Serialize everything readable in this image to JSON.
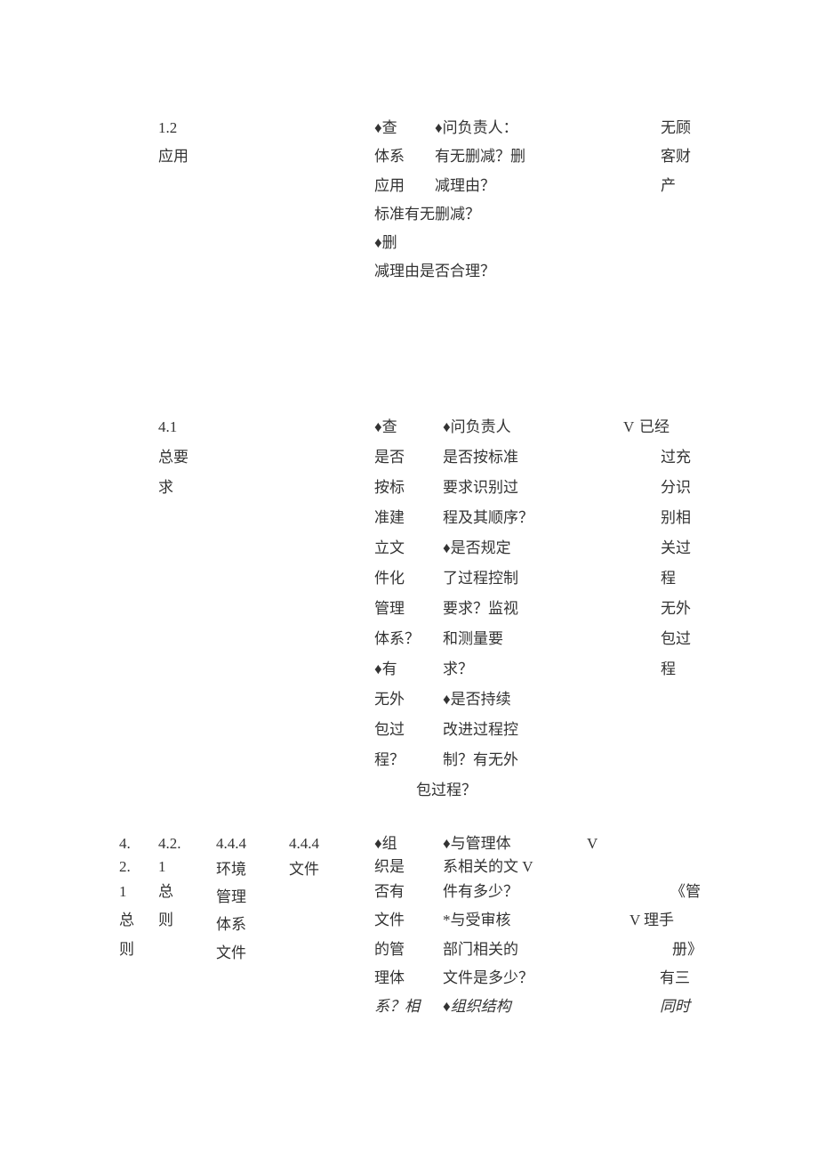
{
  "row1": {
    "c1": {
      "l1": "1.2",
      "l2": "应用"
    },
    "c4": {
      "l1": "♦查",
      "l2": "体系",
      "l3": "应用",
      "l4": "标准有无删减？",
      "l5": "♦删",
      "l6": "减理由是否合理？"
    },
    "c5": {
      "l1": "♦问负责人：",
      "l2": "有无删减？删",
      "l3": "减理由？"
    },
    "c7": {
      "l1": "无顾",
      "l2": "客财",
      "l3": "产"
    }
  },
  "row2": {
    "c1": {
      "l1": "4.1",
      "l2": "总要",
      "l3": "求"
    },
    "c4": {
      "l1": "♦查",
      "l2": "是否",
      "l3": "按标",
      "l4": "准建",
      "l5": "立文",
      "l6": "件化",
      "l7": "管理",
      "l8": "体系？",
      "l9": "♦有",
      "l10": "无外",
      "l11": "包过",
      "l12": "程？"
    },
    "c5": {
      "l1": "♦问负责人",
      "l2": "是否按标准",
      "l3": "要求识别过",
      "l4": "程及其顺序？",
      "l5": "♦是否规定",
      "l6": "了过程控制",
      "l7": "要求？监视",
      "l8": "和测量要",
      "l9": "求？",
      "l10": "♦是否持续",
      "l11": "改进过程控",
      "l12": "制？有无外",
      "l13": "包过程？"
    },
    "c6": {
      "l1": "V"
    },
    "c7": {
      "l1": "已经",
      "l2": "过充",
      "l3": "分识",
      "l4": "别相",
      "l5": "关过",
      "l6": "程",
      "l7": "",
      "l8": "无外",
      "l9": "包过",
      "l10": "程"
    }
  },
  "row3": {
    "c1a": {
      "l1": "4.",
      "l2": "2.",
      "l3": "1",
      "l4": "总",
      "l5": "则"
    },
    "c1b": {
      "l1": "4.2.",
      "l2": "1",
      "l3": "总",
      "l4": "则"
    },
    "c2a": {
      "l1": "4.4.4",
      "l2": "环境",
      "l3": "管理",
      "l4": "体系",
      "l5": "文件"
    },
    "c2b": {
      "l1": "4.4.4",
      "l2": "文件"
    },
    "c4": {
      "l1": "♦组",
      "l2": "织是",
      "l3": "否有",
      "l4": "文件",
      "l5": "的管",
      "l6": "理体",
      "l7": "系？相"
    },
    "c5": {
      "l1": "♦与管理体",
      "l2": "系相关的文 V",
      "l3": "件有多少？",
      "l4": "*与受审核",
      "l5": "部门相关的",
      "l6": "文件是多少？",
      "l7": "♦组织结构"
    },
    "c6": {
      "l1": "V",
      "l2": "",
      "l3": "",
      "l4": "V"
    },
    "c7": {
      "l1": "",
      "l2": "",
      "l3": "《管",
      "l4": "理手",
      "l5": "册》",
      "l6": "有三",
      "l7": "同时"
    }
  }
}
